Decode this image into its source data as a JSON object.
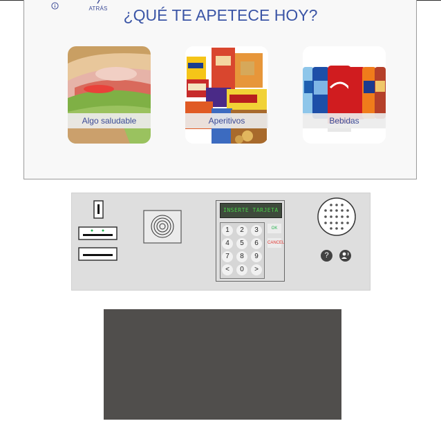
{
  "screen": {
    "back_label": "ATRÁS",
    "title": "¿QUÉ TE APETECE HOY?",
    "categories": [
      {
        "label": "Algo saludable",
        "image": "sandwich-image"
      },
      {
        "label": "Aperitivos",
        "image": "snacks-image"
      },
      {
        "label": "Bebidas",
        "image": "drinks-image"
      }
    ]
  },
  "terminal": {
    "lcd_text": "INSERTE TARJETA",
    "keys": [
      "1",
      "2",
      "3",
      "4",
      "5",
      "6",
      "7",
      "8",
      "9",
      "<",
      "0",
      ">"
    ],
    "ok_label": "OK",
    "cancel_label": "CANCEL",
    "help_label": "?",
    "colors": {
      "ok": "#22b14c",
      "cancel": "#e0332e",
      "lcd_text": "#4ad04a"
    }
  }
}
